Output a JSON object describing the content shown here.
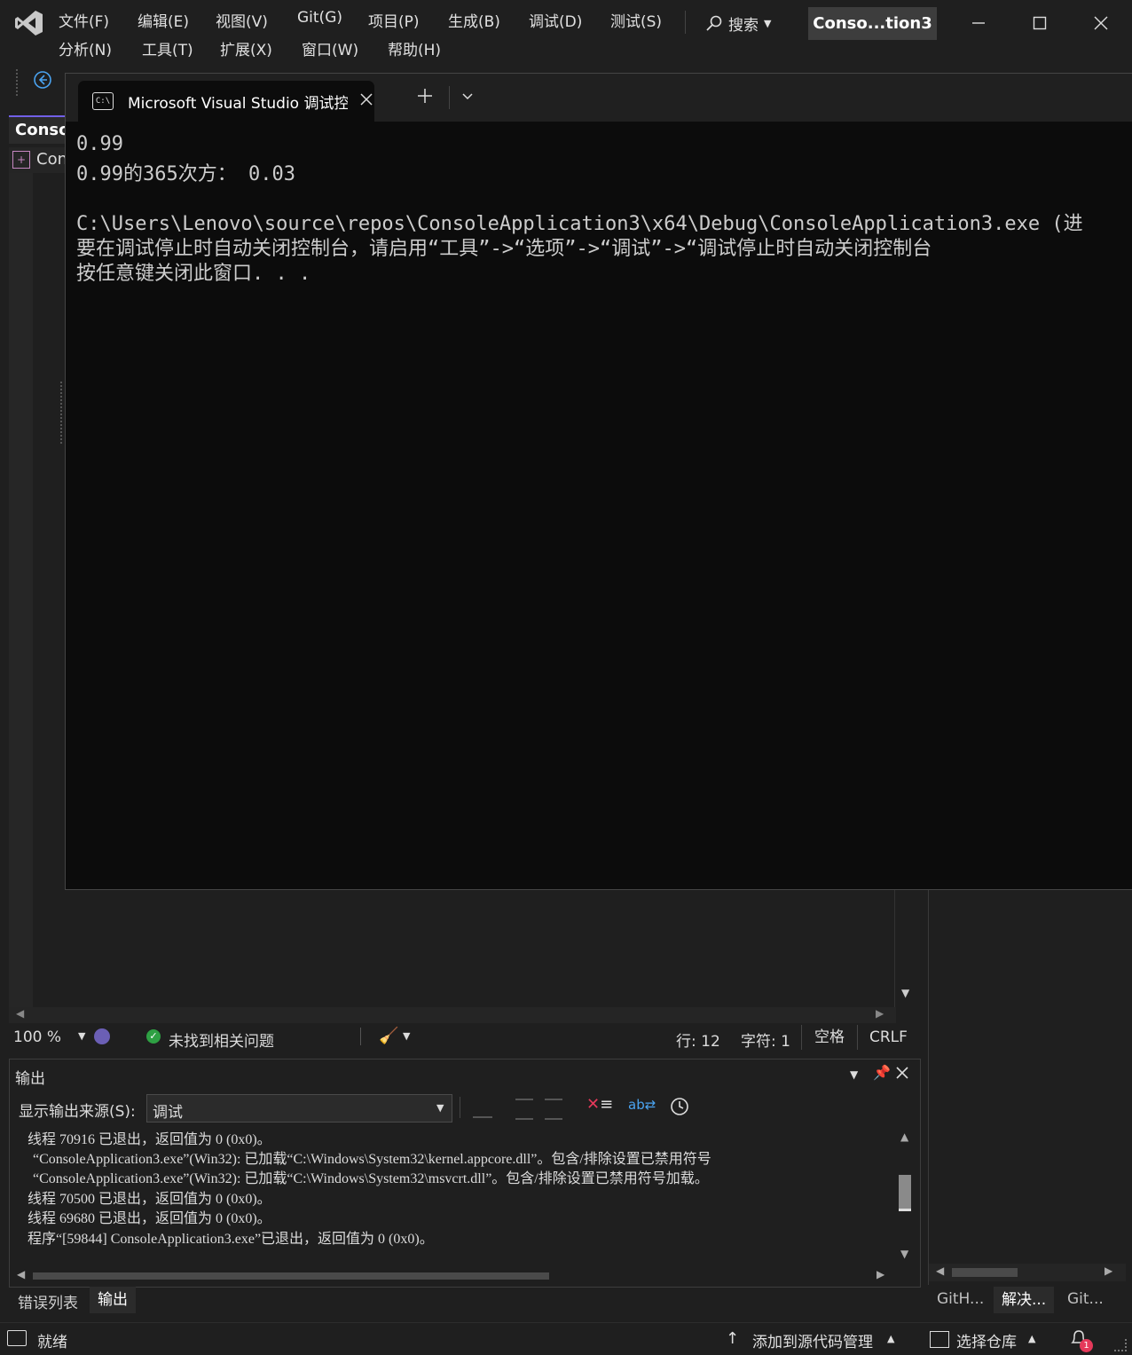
{
  "menu": {
    "row1": [
      "文件(F)",
      "编辑(E)",
      "视图(V)",
      "Git(G)",
      "项目(P)",
      "生成(B)",
      "调试(D)",
      "测试(S)"
    ],
    "row2": [
      "分析(N)",
      "工具(T)",
      "扩展(X)",
      "窗口(W)",
      "帮助(H)"
    ]
  },
  "search": {
    "label": "搜索"
  },
  "title_badge": "Conso...tion3",
  "editor": {
    "tab_label": "Conso",
    "file_label": "Con"
  },
  "console": {
    "tab_title": "Microsoft Visual Studio 调试控",
    "lines": [
      "0.99",
      "0.99的365次方： 0.03",
      "",
      "C:\\Users\\Lenovo\\source\\repos\\ConsoleApplication3\\x64\\Debug\\ConsoleApplication3.exe (进",
      "要在调试停止时自动关闭控制台，请启用“工具”->“选项”->“调试”->“调试停止时自动关闭控制台",
      "按任意键关闭此窗口. . ."
    ]
  },
  "editor_status": {
    "zoom": "100 %",
    "issues": "未找到相关问题",
    "line": "行: 12",
    "char": "字符: 1",
    "whitespace": "空格",
    "eol": "CRLF"
  },
  "output": {
    "title": "输出",
    "source_label": "显示输出来源(S):",
    "source_value": "调试",
    "lines": [
      "线程 70916 已退出，返回值为 0 (0x0)。",
      "“ConsoleApplication3.exe”(Win32): 已加载“C:\\Windows\\System32\\kernel.appcore.dll”。包含/排除设置已禁用符号",
      "“ConsoleApplication3.exe”(Win32): 已加载“C:\\Windows\\System32\\msvcrt.dll”。包含/排除设置已禁用符号加载。",
      "线程 70500 已退出，返回值为 0 (0x0)。",
      "线程 69680 已退出，返回值为 0 (0x0)。",
      "程序“[59844] ConsoleApplication3.exe”已退出，返回值为 0 (0x0)。"
    ]
  },
  "bottom_tabs": {
    "errors": "错误列表",
    "output": "输出"
  },
  "right_tabs": [
    "GitH...",
    "解决...",
    "Git..."
  ],
  "statusbar": {
    "ready": "就绪",
    "add_source": "添加到源代码管理",
    "select_repo": "选择仓库",
    "notif_count": "1"
  },
  "colors": {
    "accent": "#7160e8",
    "ok": "#2ea043",
    "notif": "#e5395a"
  }
}
